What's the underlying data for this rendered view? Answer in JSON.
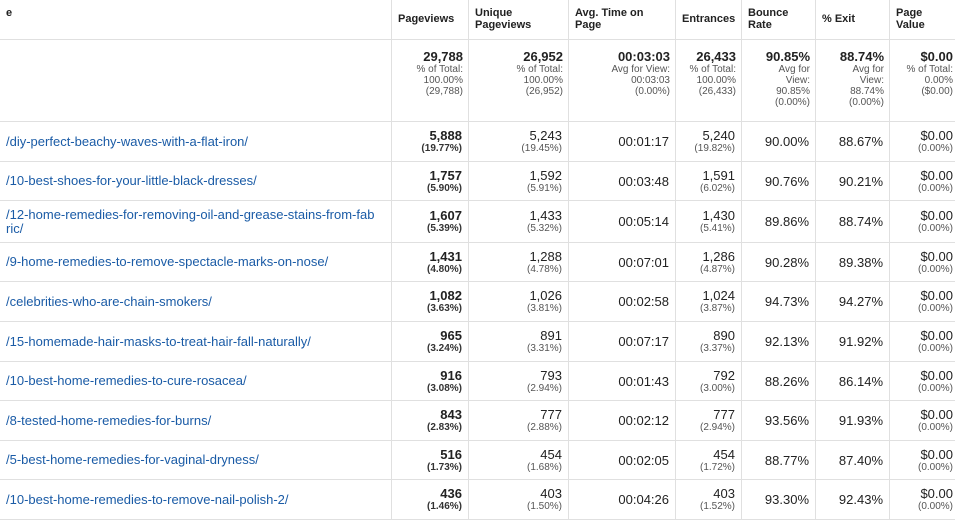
{
  "header": {
    "page": "e",
    "pageviews": "Pageviews",
    "unique_pageviews": "Unique Pageviews",
    "avg_time": "Avg. Time on Page",
    "entrances": "Entrances",
    "bounce_rate": "Bounce Rate",
    "exit": "% Exit",
    "page_value": "Page Value"
  },
  "totals": {
    "pageviews": {
      "value": "29,788",
      "l1": "% of Total:",
      "l2": "100.00%",
      "l3": "(29,788)"
    },
    "unique_pageviews": {
      "value": "26,952",
      "l1": "% of Total:",
      "l2": "100.00%",
      "l3": "(26,952)"
    },
    "avg_time": {
      "value": "00:03:03",
      "l1": "Avg for View:",
      "l2": "00:03:03",
      "l3": "(0.00%)"
    },
    "entrances": {
      "value": "26,433",
      "l1": "% of Total:",
      "l2": "100.00%",
      "l3": "(26,433)"
    },
    "bounce_rate": {
      "value": "90.85%",
      "l1": "Avg for",
      "l2": "View:",
      "l3": "90.85%",
      "l4": "(0.00%)"
    },
    "exit": {
      "value": "88.74%",
      "l1": "Avg for",
      "l2": "View:",
      "l3": "88.74%",
      "l4": "(0.00%)"
    },
    "page_value": {
      "value": "$0.00",
      "l1": "% of Total:",
      "l2": "0.00%",
      "l3": "($0.00)"
    }
  },
  "rows": [
    {
      "page": "/diy-perfect-beachy-waves-with-a-flat-iron/",
      "pv": "5,888",
      "pv_pct": "(19.77%)",
      "upv": "5,243",
      "upv_pct": "(19.45%)",
      "time": "00:01:17",
      "ent": "5,240",
      "ent_pct": "(19.82%)",
      "bounce": "90.00%",
      "exit": "88.67%",
      "value": "$0.00",
      "value_pct": "(0.00%)"
    },
    {
      "page": "/10-best-shoes-for-your-little-black-dresses/",
      "pv": "1,757",
      "pv_pct": "(5.90%)",
      "upv": "1,592",
      "upv_pct": "(5.91%)",
      "time": "00:03:48",
      "ent": "1,591",
      "ent_pct": "(6.02%)",
      "bounce": "90.76%",
      "exit": "90.21%",
      "value": "$0.00",
      "value_pct": "(0.00%)"
    },
    {
      "page": "/12-home-remedies-for-removing-oil-and-grease-stains-from-fab ric/",
      "pv": "1,607",
      "pv_pct": "(5.39%)",
      "upv": "1,433",
      "upv_pct": "(5.32%)",
      "time": "00:05:14",
      "ent": "1,430",
      "ent_pct": "(5.41%)",
      "bounce": "89.86%",
      "exit": "88.74%",
      "value": "$0.00",
      "value_pct": "(0.00%)"
    },
    {
      "page": "/9-home-remedies-to-remove-spectacle-marks-on-nose/",
      "pv": "1,431",
      "pv_pct": "(4.80%)",
      "upv": "1,288",
      "upv_pct": "(4.78%)",
      "time": "00:07:01",
      "ent": "1,286",
      "ent_pct": "(4.87%)",
      "bounce": "90.28%",
      "exit": "89.38%",
      "value": "$0.00",
      "value_pct": "(0.00%)"
    },
    {
      "page": "/celebrities-who-are-chain-smokers/",
      "pv": "1,082",
      "pv_pct": "(3.63%)",
      "upv": "1,026",
      "upv_pct": "(3.81%)",
      "time": "00:02:58",
      "ent": "1,024",
      "ent_pct": "(3.87%)",
      "bounce": "94.73%",
      "exit": "94.27%",
      "value": "$0.00",
      "value_pct": "(0.00%)"
    },
    {
      "page": "/15-homemade-hair-masks-to-treat-hair-fall-naturally/",
      "pv": "965",
      "pv_pct": "(3.24%)",
      "upv": "891",
      "upv_pct": "(3.31%)",
      "time": "00:07:17",
      "ent": "890",
      "ent_pct": "(3.37%)",
      "bounce": "92.13%",
      "exit": "91.92%",
      "value": "$0.00",
      "value_pct": "(0.00%)"
    },
    {
      "page": "/10-best-home-remedies-to-cure-rosacea/",
      "pv": "916",
      "pv_pct": "(3.08%)",
      "upv": "793",
      "upv_pct": "(2.94%)",
      "time": "00:01:43",
      "ent": "792",
      "ent_pct": "(3.00%)",
      "bounce": "88.26%",
      "exit": "86.14%",
      "value": "$0.00",
      "value_pct": "(0.00%)"
    },
    {
      "page": "/8-tested-home-remedies-for-burns/",
      "pv": "843",
      "pv_pct": "(2.83%)",
      "upv": "777",
      "upv_pct": "(2.88%)",
      "time": "00:02:12",
      "ent": "777",
      "ent_pct": "(2.94%)",
      "bounce": "93.56%",
      "exit": "91.93%",
      "value": "$0.00",
      "value_pct": "(0.00%)"
    },
    {
      "page": "/5-best-home-remedies-for-vaginal-dryness/",
      "pv": "516",
      "pv_pct": "(1.73%)",
      "upv": "454",
      "upv_pct": "(1.68%)",
      "time": "00:02:05",
      "ent": "454",
      "ent_pct": "(1.72%)",
      "bounce": "88.77%",
      "exit": "87.40%",
      "value": "$0.00",
      "value_pct": "(0.00%)"
    },
    {
      "page": "/10-best-home-remedies-to-remove-nail-polish-2/",
      "pv": "436",
      "pv_pct": "(1.46%)",
      "upv": "403",
      "upv_pct": "(1.50%)",
      "time": "00:04:26",
      "ent": "403",
      "ent_pct": "(1.52%)",
      "bounce": "93.30%",
      "exit": "92.43%",
      "value": "$0.00",
      "value_pct": "(0.00%)"
    }
  ]
}
